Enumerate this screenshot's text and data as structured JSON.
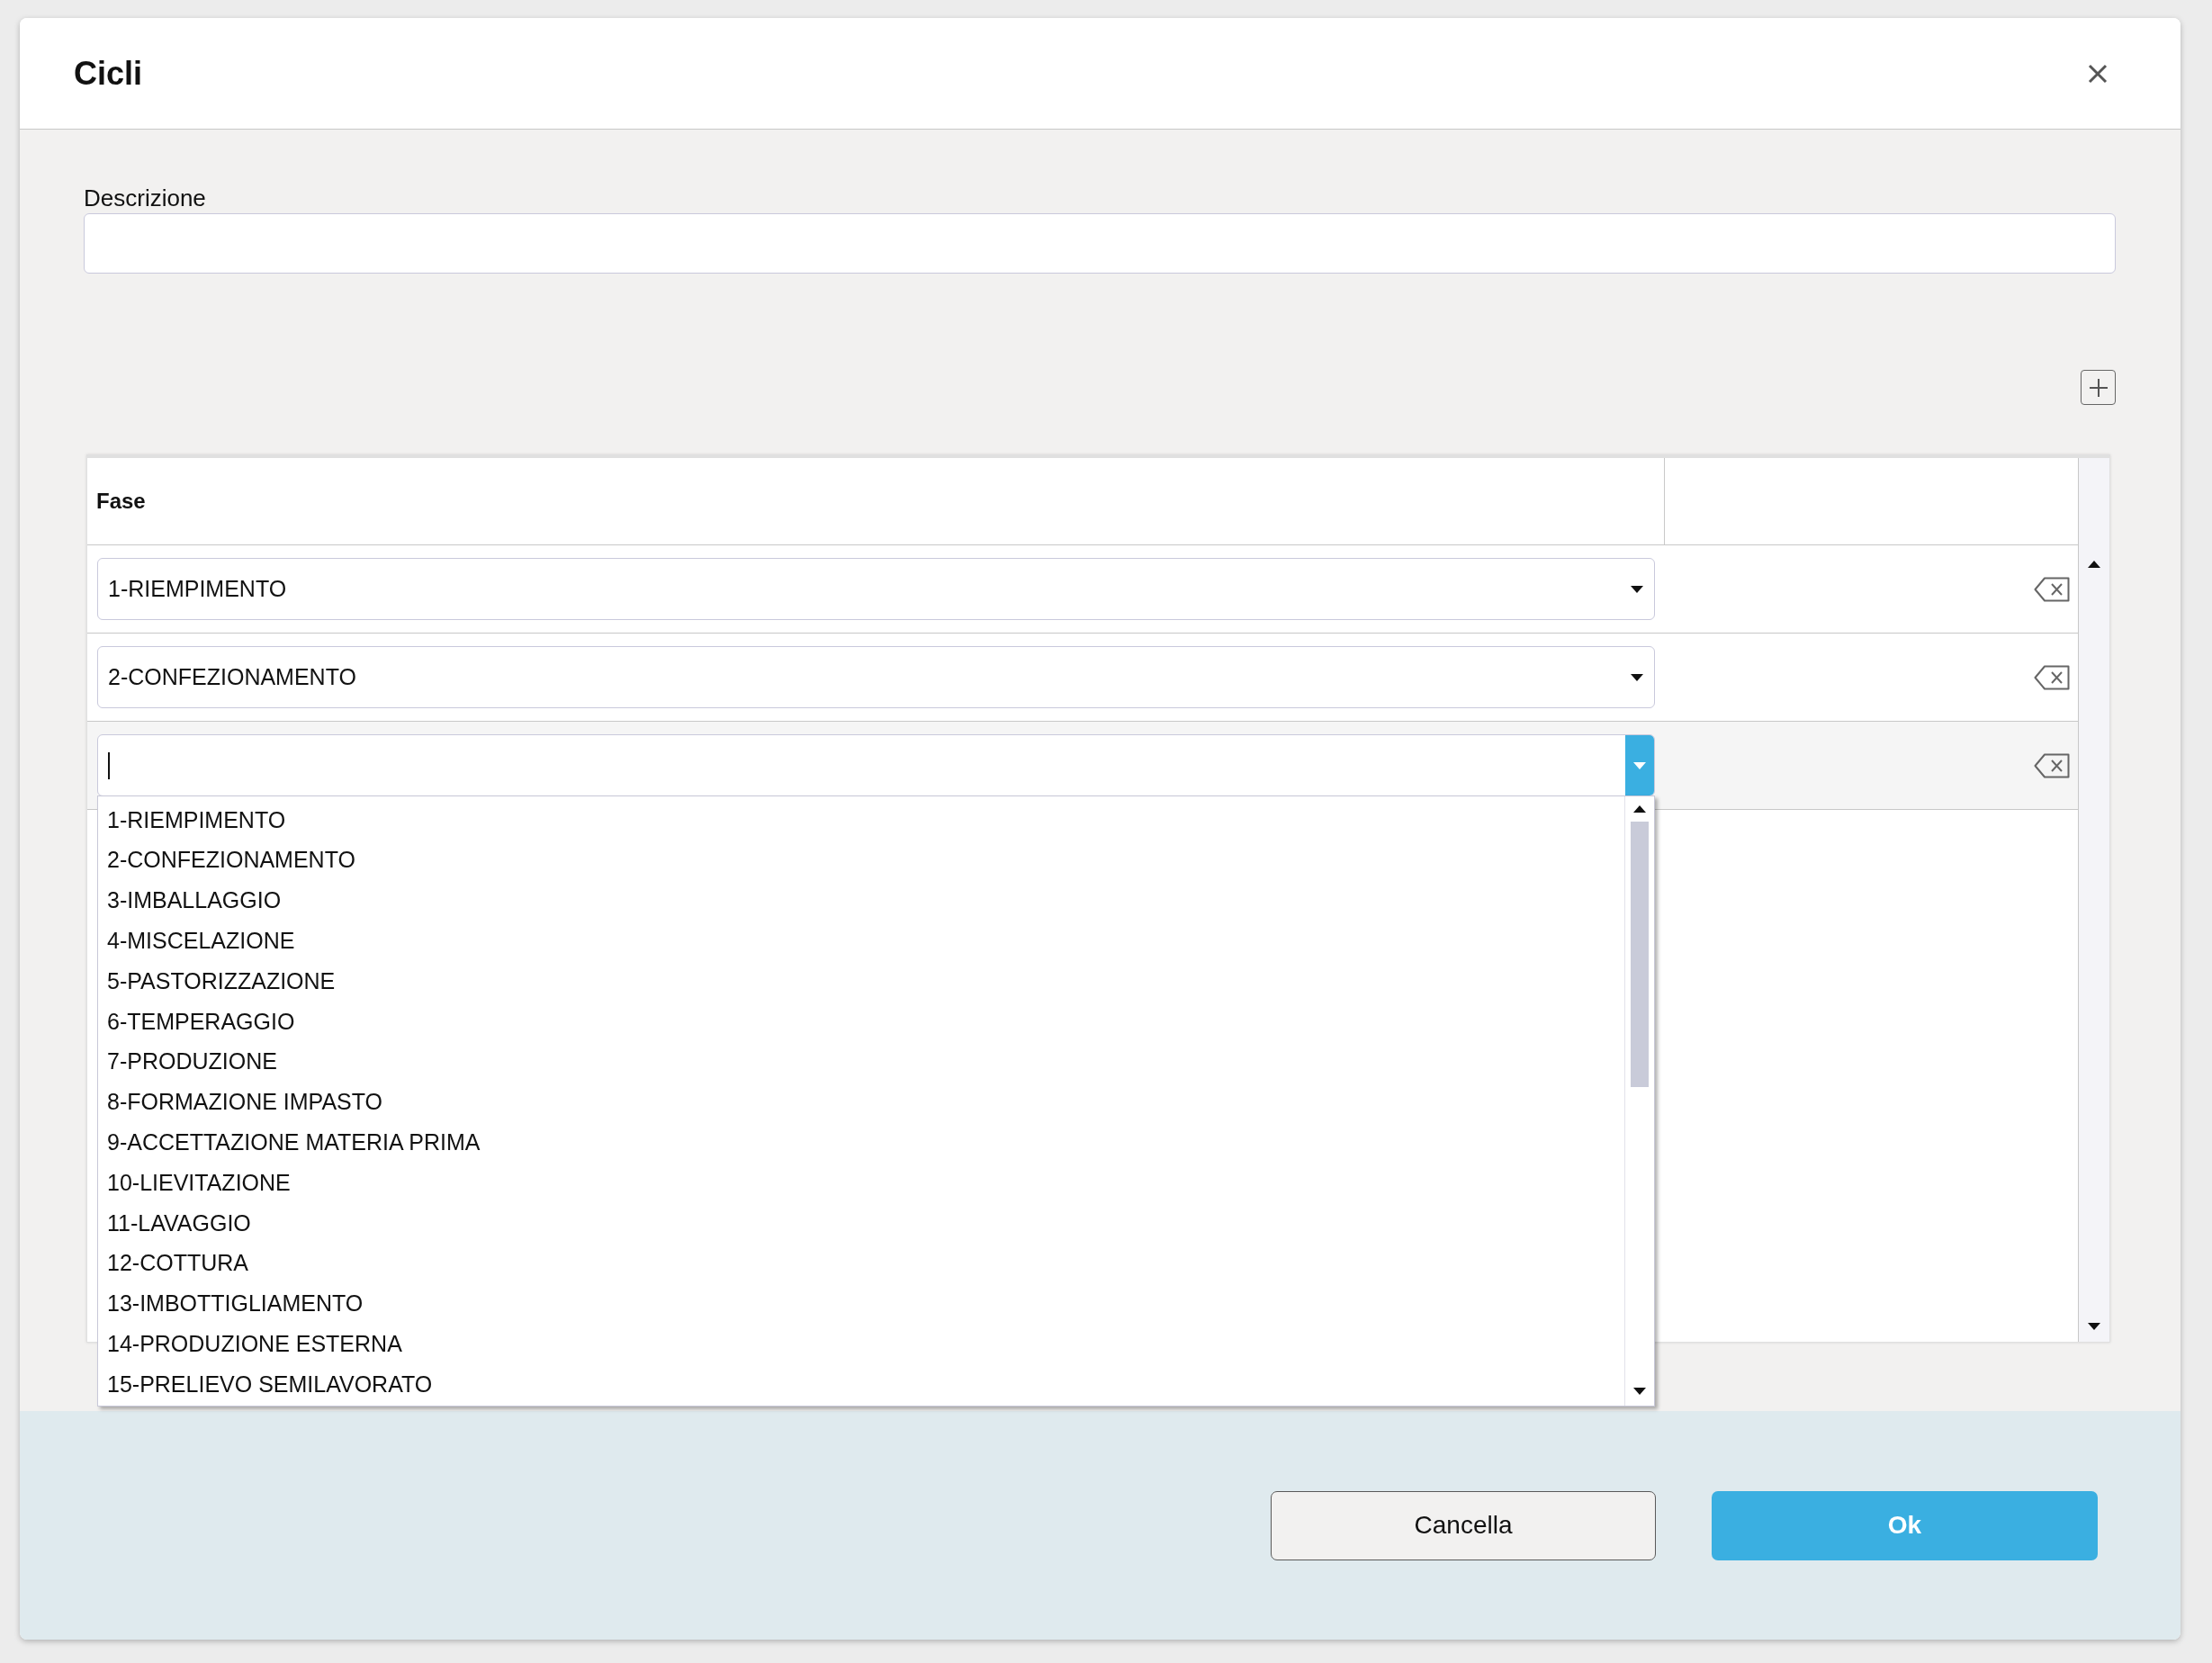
{
  "dialog": {
    "title": "Cicli"
  },
  "description": {
    "label": "Descrizione"
  },
  "table": {
    "columns": [
      "Fase"
    ],
    "rows": [
      {
        "value": "1-RIEMPIMENTO",
        "expanded": false
      },
      {
        "value": "2-CONFEZIONAMENTO",
        "expanded": false
      },
      {
        "expanded": true
      }
    ]
  },
  "dropdown": {
    "options": [
      {
        "label": "1-RIEMPIMENTO",
        "selected": false
      },
      {
        "label": "2-CONFEZIONAMENTO",
        "selected": false
      },
      {
        "label": "3-IMBALLAGGIO",
        "selected": false
      },
      {
        "label": "4-MISCELAZIONE",
        "selected": false
      },
      {
        "label": "5-PASTORIZZAZIONE",
        "selected": false
      },
      {
        "label": "6-TEMPERAGGIO",
        "selected": false
      },
      {
        "label": "7-PRODUZIONE",
        "selected": false
      },
      {
        "label": "8-FORMAZIONE IMPASTO",
        "selected": false
      },
      {
        "label": "9-ACCETTAZIONE MATERIA PRIMA",
        "selected": false
      },
      {
        "label": "10-LIEVITAZIONE",
        "selected": false
      },
      {
        "label": "11-LAVAGGIO",
        "selected": false
      },
      {
        "label": "12-COTTURA",
        "selected": false
      },
      {
        "label": "13-IMBOTTIGLIAMENTO",
        "selected": false
      },
      {
        "label": "14-PRODUZIONE ESTERNA",
        "selected": false
      },
      {
        "label": "15-PRELIEVO SEMILAVORATO",
        "selected": false
      }
    ]
  },
  "buttons": [
    {
      "label": "Cancella",
      "kind": "secondary"
    },
    {
      "label": "Ok",
      "kind": "primary"
    }
  ]
}
